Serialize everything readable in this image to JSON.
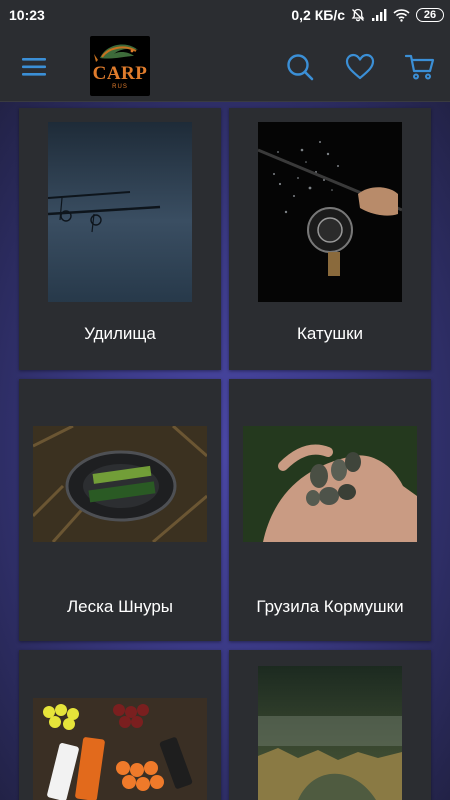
{
  "status_bar": {
    "time": "10:23",
    "network_speed": "0,2 КБ/с",
    "battery": "26",
    "icons": [
      "mute-bell-icon",
      "signal-icon",
      "wifi-icon",
      "battery-icon"
    ]
  },
  "header": {
    "logo_text": "CARP",
    "logo_sub": "RUS",
    "actions": [
      "menu-icon",
      "search-icon",
      "heart-icon",
      "cart-icon"
    ],
    "accent_color": "#3b8fd6"
  },
  "categories": [
    {
      "label": "Удилища"
    },
    {
      "label": "Катушки"
    },
    {
      "label": "Леска Шнуры"
    },
    {
      "label": "Грузила Кормушки"
    },
    {
      "label": ""
    },
    {
      "label": ""
    }
  ]
}
